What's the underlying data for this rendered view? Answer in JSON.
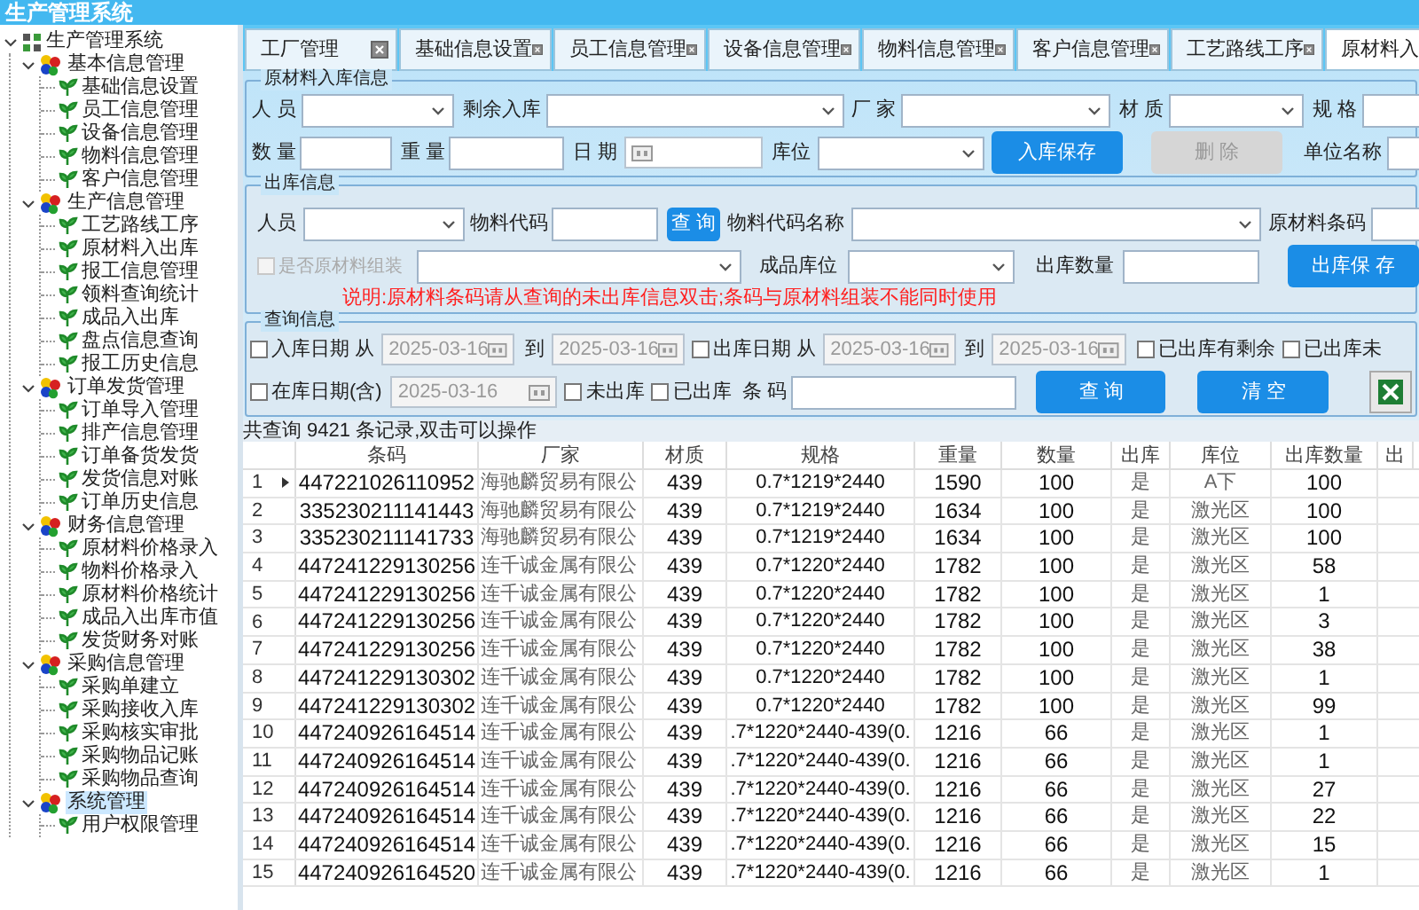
{
  "window": {
    "title": "生产管理系统"
  },
  "tree": {
    "label": "生产管理系统",
    "expanded": true,
    "children": [
      {
        "label": "基本信息管理",
        "expanded": true,
        "selected": false,
        "children": [
          {
            "label": "基础信息设置",
            "selected": false
          },
          {
            "label": "员工信息管理",
            "selected": false
          },
          {
            "label": "设备信息管理",
            "selected": false
          },
          {
            "label": "物料信息管理",
            "selected": false
          },
          {
            "label": "客户信息管理",
            "selected": false
          }
        ]
      },
      {
        "label": "生产信息管理",
        "expanded": true,
        "selected": false,
        "children": [
          {
            "label": "工艺路线工序",
            "selected": false
          },
          {
            "label": "原材料入出库",
            "selected": false
          },
          {
            "label": "报工信息管理",
            "selected": false
          },
          {
            "label": "领料查询统计",
            "selected": false
          },
          {
            "label": "成品入出库",
            "selected": false
          },
          {
            "label": "盘点信息查询",
            "selected": false
          },
          {
            "label": "报工历史信息",
            "selected": false
          }
        ]
      },
      {
        "label": "订单发货管理",
        "expanded": true,
        "selected": false,
        "children": [
          {
            "label": "订单导入管理",
            "selected": false
          },
          {
            "label": "排产信息管理",
            "selected": false
          },
          {
            "label": "订单备货发货",
            "selected": false
          },
          {
            "label": "发货信息对账",
            "selected": false
          },
          {
            "label": "订单历史信息",
            "selected": false
          }
        ]
      },
      {
        "label": "财务信息管理",
        "expanded": true,
        "selected": false,
        "children": [
          {
            "label": "原材料价格录入",
            "selected": false
          },
          {
            "label": "物料价格录入",
            "selected": false
          },
          {
            "label": "原材料价格统计",
            "selected": false
          },
          {
            "label": "成品入出库市值",
            "selected": false
          },
          {
            "label": "发货财务对账",
            "selected": false
          }
        ]
      },
      {
        "label": "采购信息管理",
        "expanded": true,
        "selected": false,
        "children": [
          {
            "label": "采购单建立",
            "selected": false
          },
          {
            "label": "采购接收入库",
            "selected": false
          },
          {
            "label": "采购核实审批",
            "selected": false
          },
          {
            "label": "采购物品记账",
            "selected": false
          },
          {
            "label": "采购物品查询",
            "selected": false
          }
        ]
      },
      {
        "label": "系统管理",
        "expanded": true,
        "selected": true,
        "children": [
          {
            "label": "用户权限管理",
            "selected": false
          }
        ]
      }
    ]
  },
  "tabs": [
    {
      "label": "工厂管理",
      "selected": false
    },
    {
      "label": "基础信息设置",
      "selected": false
    },
    {
      "label": "员工信息管理",
      "selected": false
    },
    {
      "label": "设备信息管理",
      "selected": false
    },
    {
      "label": "物料信息管理",
      "selected": false
    },
    {
      "label": "客户信息管理",
      "selected": false
    },
    {
      "label": "工艺路线工序",
      "selected": false
    },
    {
      "label": "原材料入",
      "selected": true
    }
  ],
  "inbound": {
    "title": "原材料入库信息",
    "line_1": [
      {
        "kind": "label",
        "text": "人 员"
      },
      {
        "kind": "combo"
      },
      {
        "kind": "label",
        "text": "剩余入库"
      },
      {
        "kind": "combo"
      },
      {
        "kind": "label",
        "text": "厂 家"
      },
      {
        "kind": "combo"
      },
      {
        "kind": "label",
        "text": "材 质"
      },
      {
        "kind": "combo"
      },
      {
        "kind": "label",
        "text": "规 格"
      },
      {
        "kind": "text"
      }
    ],
    "line_2": [
      {
        "kind": "label",
        "text": "数 量"
      },
      {
        "kind": "text"
      },
      {
        "kind": "label",
        "text": "重 量"
      },
      {
        "kind": "text"
      },
      {
        "kind": "label",
        "text": "日 期"
      },
      {
        "kind": "date"
      },
      {
        "kind": "label",
        "text": "库位"
      },
      {
        "kind": "combo"
      },
      {
        "kind": "button",
        "text": "入库保存",
        "disabled": false
      },
      {
        "kind": "button",
        "text": "删 除",
        "disabled": true
      },
      {
        "kind": "label",
        "text": "单位名称"
      },
      {
        "kind": "text"
      }
    ]
  },
  "outbound": {
    "title": "出库信息",
    "line_1": [
      {
        "kind": "label",
        "text": "人员"
      },
      {
        "kind": "combo"
      },
      {
        "kind": "label",
        "text": "物料代码"
      },
      {
        "kind": "text"
      },
      {
        "kind": "button",
        "text": "查 询",
        "disabled": false
      },
      {
        "kind": "label",
        "text": "物料代码名称"
      },
      {
        "kind": "combo"
      },
      {
        "kind": "label",
        "text": "原材料条码"
      },
      {
        "kind": "text"
      }
    ],
    "line_2": [
      {
        "kind": "checkbox",
        "text": "是否原材料组装",
        "checked": false,
        "disabled": true
      },
      {
        "kind": "combo"
      },
      {
        "kind": "label",
        "text": "成品库位"
      },
      {
        "kind": "combo"
      },
      {
        "kind": "label",
        "text": "出库数量"
      },
      {
        "kind": "text"
      },
      {
        "kind": "button",
        "text": "出库保 存",
        "disabled": false
      }
    ],
    "note": "说明:原材料条码请从查询的未出库信息双击;条码与原材料组装不能同时使用"
  },
  "query": {
    "title": "查询信息",
    "line_1": [
      {
        "kind": "checkbox",
        "text": "入库日期 从",
        "checked": false,
        "disabled": false
      },
      {
        "kind": "date",
        "value": "2025-03-16",
        "disabled": true
      },
      {
        "kind": "label",
        "text": "到"
      },
      {
        "kind": "date",
        "value": "2025-03-16",
        "disabled": true
      },
      {
        "kind": "checkbox",
        "text": "出库日期 从",
        "checked": false,
        "disabled": false
      },
      {
        "kind": "date",
        "value": "2025-03-16",
        "disabled": true
      },
      {
        "kind": "label",
        "text": "到"
      },
      {
        "kind": "date",
        "value": "2025-03-16",
        "disabled": true
      },
      {
        "kind": "checkbox",
        "text": "已出库有剩余",
        "checked": false,
        "disabled": false
      },
      {
        "kind": "checkbox",
        "text": "已出库未",
        "checked": false,
        "disabled": false
      }
    ],
    "line_2": [
      {
        "kind": "checkbox",
        "text": "在库日期(含)",
        "checked": false,
        "disabled": false
      },
      {
        "kind": "date",
        "value": "2025-03-16",
        "disabled": true
      },
      {
        "kind": "checkbox",
        "text": "未出库",
        "checked": false,
        "disabled": false
      },
      {
        "kind": "checkbox",
        "text": "已出库",
        "checked": false,
        "disabled": false
      },
      {
        "kind": "label",
        "text": "条 码"
      },
      {
        "kind": "text"
      },
      {
        "kind": "button",
        "text": "查 询",
        "disabled": false
      },
      {
        "kind": "button",
        "text": "清 空",
        "disabled": false
      },
      {
        "kind": "excel"
      }
    ]
  },
  "result_count": "共查询 9421 条记录,双击可以操作",
  "table": {
    "columns": [
      "",
      "条码",
      "厂家",
      "材质",
      "规格",
      "重量",
      "数量",
      "出库",
      "库位",
      "出库数量",
      "出"
    ],
    "rows": [
      {
        "selected": true,
        "cells": [
          "1",
          "447221026110952",
          "海驰麟贸易有限公",
          "439",
          "0.7*1219*2440",
          "1590",
          "100",
          "是",
          "A下",
          "100"
        ]
      },
      {
        "selected": false,
        "cells": [
          "2",
          "335230211141443",
          "海驰麟贸易有限公",
          "439",
          "0.7*1219*2440",
          "1634",
          "100",
          "是",
          "激光区",
          "100"
        ]
      },
      {
        "selected": false,
        "cells": [
          "3",
          "335230211141733",
          "海驰麟贸易有限公",
          "439",
          "0.7*1219*2440",
          "1634",
          "100",
          "是",
          "激光区",
          "100"
        ]
      },
      {
        "selected": false,
        "cells": [
          "4",
          "447241229130256",
          "连千诚金属有限公",
          "439",
          "0.7*1220*2440",
          "1782",
          "100",
          "是",
          "激光区",
          "58"
        ]
      },
      {
        "selected": false,
        "cells": [
          "5",
          "447241229130256",
          "连千诚金属有限公",
          "439",
          "0.7*1220*2440",
          "1782",
          "100",
          "是",
          "激光区",
          "1"
        ]
      },
      {
        "selected": false,
        "cells": [
          "6",
          "447241229130256",
          "连千诚金属有限公",
          "439",
          "0.7*1220*2440",
          "1782",
          "100",
          "是",
          "激光区",
          "3"
        ]
      },
      {
        "selected": false,
        "cells": [
          "7",
          "447241229130256",
          "连千诚金属有限公",
          "439",
          "0.7*1220*2440",
          "1782",
          "100",
          "是",
          "激光区",
          "38"
        ]
      },
      {
        "selected": false,
        "cells": [
          "8",
          "447241229130302",
          "连千诚金属有限公",
          "439",
          "0.7*1220*2440",
          "1782",
          "100",
          "是",
          "激光区",
          "1"
        ]
      },
      {
        "selected": false,
        "cells": [
          "9",
          "447241229130302",
          "连千诚金属有限公",
          "439",
          "0.7*1220*2440",
          "1782",
          "100",
          "是",
          "激光区",
          "99"
        ]
      },
      {
        "selected": false,
        "cells": [
          "10",
          "447240926164514",
          "连千诚金属有限公",
          "439",
          ".7*1220*2440-439(0.",
          "1216",
          "66",
          "是",
          "激光区",
          "1"
        ]
      },
      {
        "selected": false,
        "cells": [
          "11",
          "447240926164514",
          "连千诚金属有限公",
          "439",
          ".7*1220*2440-439(0.",
          "1216",
          "66",
          "是",
          "激光区",
          "1"
        ]
      },
      {
        "selected": false,
        "cells": [
          "12",
          "447240926164514",
          "连千诚金属有限公",
          "439",
          ".7*1220*2440-439(0.",
          "1216",
          "66",
          "是",
          "激光区",
          "27"
        ]
      },
      {
        "selected": false,
        "cells": [
          "13",
          "447240926164514",
          "连千诚金属有限公",
          "439",
          ".7*1220*2440-439(0.",
          "1216",
          "66",
          "是",
          "激光区",
          "22"
        ]
      },
      {
        "selected": false,
        "cells": [
          "14",
          "447240926164514",
          "连千诚金属有限公",
          "439",
          ".7*1220*2440-439(0.",
          "1216",
          "66",
          "是",
          "激光区",
          "15"
        ]
      },
      {
        "selected": false,
        "cells": [
          "15",
          "447240926164520",
          "连千诚金属有限公",
          "439",
          ".7*1220*2440-439(0.",
          "1216",
          "66",
          "是",
          "激光区",
          "1"
        ]
      }
    ]
  }
}
